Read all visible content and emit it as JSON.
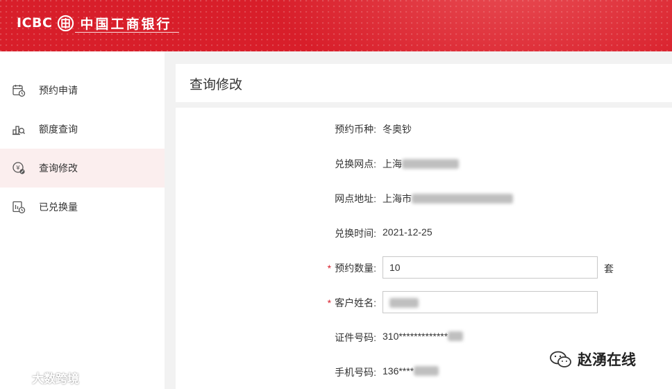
{
  "header": {
    "logo_en": "ICBC",
    "logo_cn": "中国工商银行",
    "brand_color": "#d81e2a"
  },
  "sidebar": {
    "items": [
      {
        "label": "预约申请",
        "icon": "calendar-clock-icon",
        "active": false
      },
      {
        "label": "额度查询",
        "icon": "coin-stack-search-icon",
        "active": false
      },
      {
        "label": "查询修改",
        "icon": "yuan-coin-edit-icon",
        "active": true
      },
      {
        "label": "已兑换量",
        "icon": "chart-clock-icon",
        "active": false
      }
    ],
    "active_bg": "#fbeeee"
  },
  "main": {
    "title": "查询修改",
    "form": {
      "currency": {
        "label": "预约币种:",
        "value": "冬奥钞"
      },
      "branch": {
        "label": "兑换网点:",
        "value_prefix": "上海"
      },
      "address": {
        "label": "网点地址:",
        "value_prefix": "上海市"
      },
      "date": {
        "label": "兑换时间:",
        "value": "2021-12-25"
      },
      "quantity": {
        "label": "预约数量:",
        "required_mark": "*",
        "value": "10",
        "unit": "套"
      },
      "name": {
        "label": "客户姓名:",
        "required_mark": "*"
      },
      "id_number": {
        "label": "证件号码:",
        "value_prefix": "310*************"
      },
      "phone": {
        "label": "手机号码:",
        "value_prefix": "136****"
      }
    }
  },
  "watermarks": {
    "left": "大数跨境",
    "right": "赵湧在线"
  }
}
